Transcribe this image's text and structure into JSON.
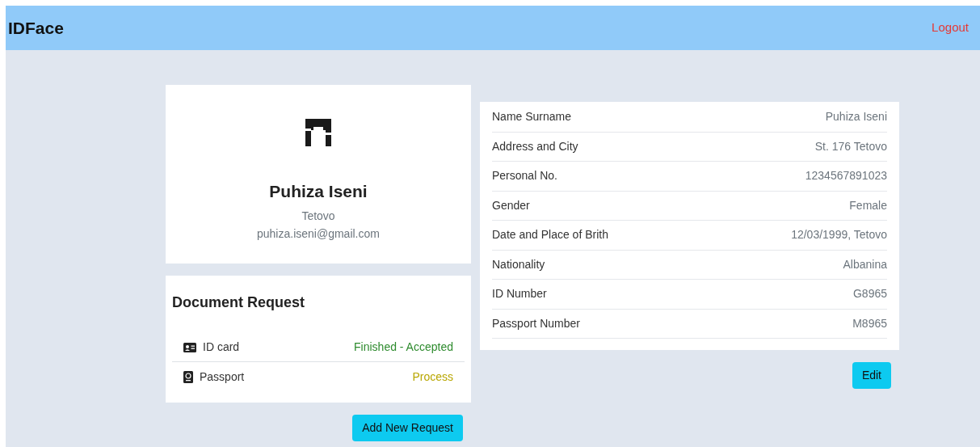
{
  "navbar": {
    "brand": "IDFace",
    "logout": "Logout"
  },
  "profile": {
    "name": "Puhiza Iseni",
    "city": "Tetovo",
    "email": "puhiza.iseni@gmail.com"
  },
  "requests": {
    "title": "Document Request",
    "items": [
      {
        "kind": "id_card",
        "label": "ID card",
        "status": "Finished - Accepted",
        "color": "#2e8b2e"
      },
      {
        "kind": "passport",
        "label": "Passport",
        "status": "Process",
        "color": "#b8a600"
      }
    ],
    "button": "Add New Request"
  },
  "details": {
    "rows": [
      {
        "label": "Name Surname",
        "value": "Puhiza Iseni"
      },
      {
        "label": "Address and City",
        "value": "St. 176 Tetovo"
      },
      {
        "label": "Personal No.",
        "value": "1234567891023"
      },
      {
        "label": "Gender",
        "value": "Female"
      },
      {
        "label": "Date and Place of Brith",
        "value": "12/03/1999, Tetovo"
      },
      {
        "label": "Nationality",
        "value": "Albanina"
      },
      {
        "label": "ID Number",
        "value": "G8965"
      },
      {
        "label": "Passport Number",
        "value": "M8965"
      }
    ],
    "button": "Edit"
  }
}
